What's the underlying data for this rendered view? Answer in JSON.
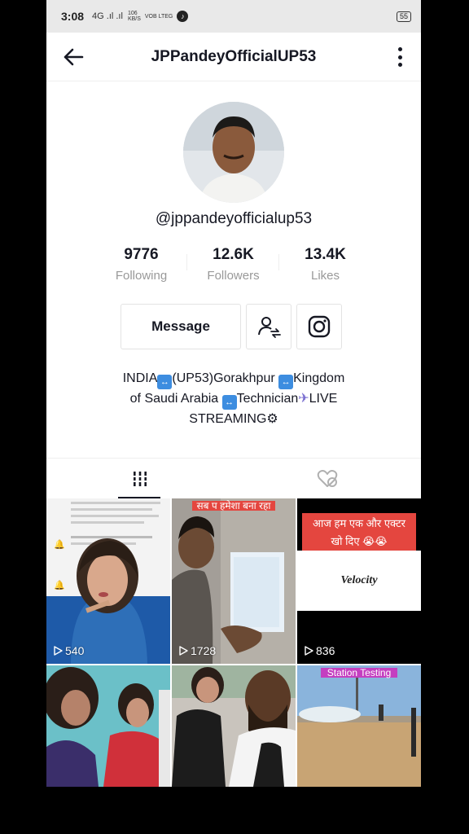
{
  "status_bar": {
    "time": "3:08",
    "signal": "4G .ıl .ıl",
    "speed_value": "106",
    "speed_unit": "KB/S",
    "network": "VOB LTEG",
    "battery": "55"
  },
  "header": {
    "title": "JPPandeyOfficialUP53",
    "back_icon": "arrow-left-icon",
    "more_icon": "more-vertical-icon"
  },
  "profile": {
    "handle": "@jppandeyofficialup53",
    "stats": [
      {
        "value": "9776",
        "label": "Following"
      },
      {
        "value": "12.6K",
        "label": "Followers"
      },
      {
        "value": "13.4K",
        "label": "Likes"
      }
    ],
    "message_label": "Message",
    "bio": {
      "line1_a": "INDIA",
      "line1_b": "(UP53)Gorakhpur",
      "line1_c": "Kingdom",
      "line2_a": "of Saudi Arabia",
      "line2_b": "Technician",
      "line2_c": "LIVE",
      "line3": "STREAMING"
    }
  },
  "tabs": [
    {
      "name": "videos-grid-icon",
      "active": true
    },
    {
      "name": "liked-videos-icon",
      "active": false
    }
  ],
  "videos": [
    {
      "views": "540"
    },
    {
      "views": "1728",
      "caption": "सब प हमेशा बना रहा"
    },
    {
      "views": "836",
      "caption": "आज हम एक और एक्टर खो दिए 😭😭",
      "logo": "Velocity"
    },
    {
      "views": ""
    },
    {
      "views": ""
    },
    {
      "views": "",
      "caption": "Station Testing"
    }
  ],
  "colors": {
    "accent_red": "#e4463f",
    "text_primary": "#161823",
    "text_secondary": "#999999"
  }
}
